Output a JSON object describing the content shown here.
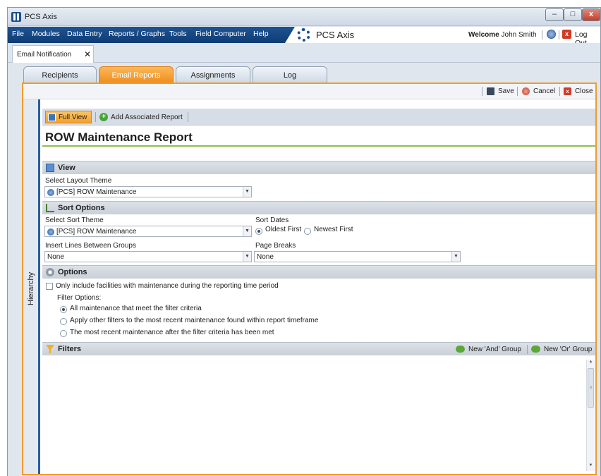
{
  "window": {
    "title": "PCS Axis",
    "min": "–",
    "max": "□",
    "close": "x"
  },
  "menu": {
    "items": [
      "File",
      "Modules",
      "Data Entry",
      "Reports / Graphs",
      "Tools",
      "Field Computer",
      "Help"
    ],
    "brand": "PCS Axis",
    "welcome_label": "Welcome",
    "user": "John Smith",
    "logout": "Log Out"
  },
  "doc_tab": {
    "label": "Email Notification",
    "close": "✕"
  },
  "tabs": [
    "Recipients",
    "Email Reports",
    "Assignments",
    "Log"
  ],
  "active_tab": "Email Reports",
  "toolbar": {
    "save": "Save",
    "cancel": "Cancel",
    "close": "Close"
  },
  "side_panel": {
    "label": "Hierarchy"
  },
  "report_bar": {
    "full_view": "Full View",
    "add_associated": "Add Associated Report"
  },
  "report_title": "ROW Maintenance Report",
  "view_section": {
    "title": "View",
    "layout_theme_label": "Select Layout Theme",
    "layout_theme_value": "[PCS] ROW Maintenance"
  },
  "sort_section": {
    "title": "Sort Options",
    "sort_theme_label": "Select Sort Theme",
    "sort_theme_value": "[PCS] ROW Maintenance",
    "sort_dates_label": "Sort Dates",
    "oldest_first": "Oldest First",
    "newest_first": "Newest First",
    "sort_dates_selected": "Oldest First",
    "insert_lines_label": "Insert Lines Between Groups",
    "insert_lines_value": "None",
    "page_breaks_label": "Page Breaks",
    "page_breaks_value": "None"
  },
  "options_section": {
    "title": "Options",
    "only_include_label": "Only include facilities with maintenance during the reporting time period",
    "only_include_checked": false,
    "filter_options_label": "Filter Options:",
    "filter_options": [
      "All maintenance that meet the filter criteria",
      "Apply other filters to the most recent maintenance found within report timeframe",
      "The most recent maintenance after the filter criteria has been met"
    ],
    "filter_selected": "All maintenance that meet the filter criteria"
  },
  "filters_section": {
    "title": "Filters",
    "new_and_group": "New 'And' Group",
    "new_or_group": "New 'Or' Group"
  },
  "colors": {
    "accent_orange": "#f29a2e",
    "menu_blue": "#1e5392",
    "green_rule": "#8dc04d"
  }
}
